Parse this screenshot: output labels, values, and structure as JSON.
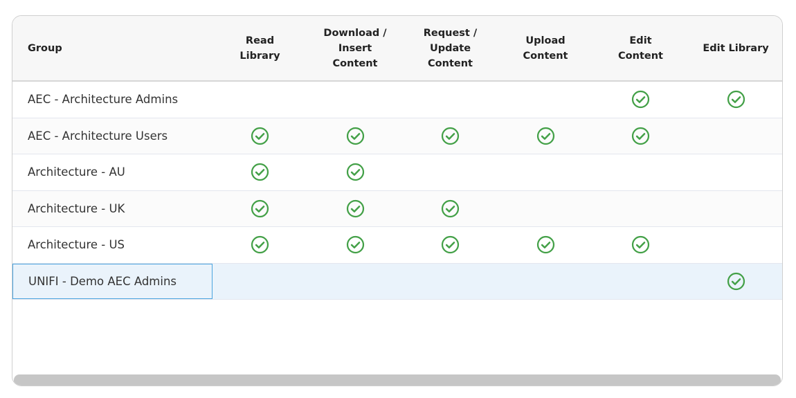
{
  "table": {
    "columns": [
      {
        "key": "group",
        "label": "Group"
      },
      {
        "key": "read_library",
        "label": "Read\nLibrary"
      },
      {
        "key": "download_insert",
        "label": "Download /\nInsert\nContent"
      },
      {
        "key": "request_update",
        "label": "Request /\nUpdate\nContent"
      },
      {
        "key": "upload_content",
        "label": "Upload\nContent"
      },
      {
        "key": "edit_content",
        "label": "Edit\nContent"
      },
      {
        "key": "edit_library",
        "label": "Edit Library"
      }
    ],
    "rows": [
      {
        "group": "AEC - Architecture Admins",
        "permissions": [
          false,
          false,
          false,
          false,
          true,
          true
        ]
      },
      {
        "group": "AEC - Architecture Users",
        "permissions": [
          true,
          true,
          true,
          true,
          true,
          false
        ]
      },
      {
        "group": "Architecture - AU",
        "permissions": [
          true,
          true,
          false,
          false,
          false,
          false
        ]
      },
      {
        "group": "Architecture - UK",
        "permissions": [
          true,
          true,
          true,
          false,
          false,
          false
        ]
      },
      {
        "group": "Architecture - US",
        "permissions": [
          true,
          true,
          true,
          true,
          true,
          false
        ]
      },
      {
        "group": "UNIFI - Demo AEC Admins",
        "permissions": [
          false,
          false,
          false,
          false,
          false,
          true
        ]
      }
    ],
    "selected_row": 5
  },
  "icons": {
    "granted": "check-circle-icon"
  },
  "colors": {
    "check": "#43a047",
    "selection_border": "#4aa3df",
    "selected_row_bg": "#eaf3fb"
  }
}
